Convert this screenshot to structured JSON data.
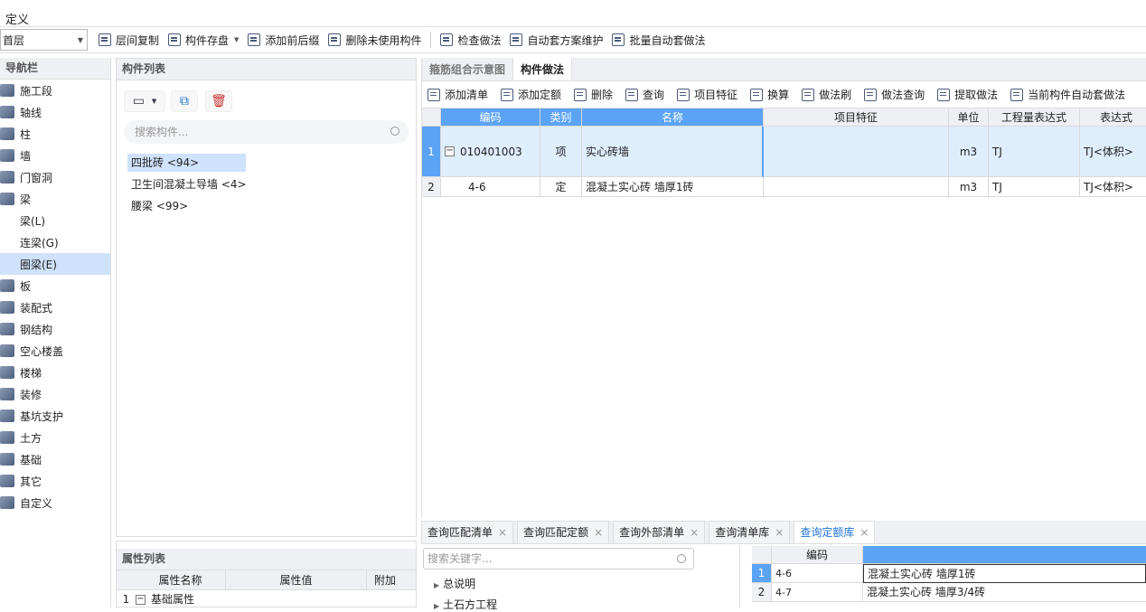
{
  "menu": {
    "title": "定义"
  },
  "toolbar": {
    "floor": "首层",
    "buttons": [
      "层间复制",
      "构件存盘",
      "添加前后缀",
      "删除未使用构件",
      "检查做法",
      "自动套方案维护",
      "批量自动套做法"
    ]
  },
  "nav": {
    "title": "导航栏",
    "items": [
      {
        "label": "施工段",
        "sub": false,
        "sel": false
      },
      {
        "label": "轴线",
        "sub": false,
        "sel": false
      },
      {
        "label": "柱",
        "sub": false,
        "sel": false
      },
      {
        "label": "墙",
        "sub": false,
        "sel": false
      },
      {
        "label": "门窗洞",
        "sub": false,
        "sel": false
      },
      {
        "label": "梁",
        "sub": false,
        "sel": false
      },
      {
        "label": "梁(L)",
        "sub": true,
        "sel": false
      },
      {
        "label": "连梁(G)",
        "sub": true,
        "sel": false
      },
      {
        "label": "圈梁(E)",
        "sub": true,
        "sel": true
      },
      {
        "label": "板",
        "sub": false,
        "sel": false
      },
      {
        "label": "装配式",
        "sub": false,
        "sel": false
      },
      {
        "label": "钢结构",
        "sub": false,
        "sel": false
      },
      {
        "label": "空心楼盖",
        "sub": false,
        "sel": false
      },
      {
        "label": "楼梯",
        "sub": false,
        "sel": false
      },
      {
        "label": "装修",
        "sub": false,
        "sel": false
      },
      {
        "label": "基坑支护",
        "sub": false,
        "sel": false
      },
      {
        "label": "土方",
        "sub": false,
        "sel": false
      },
      {
        "label": "基础",
        "sub": false,
        "sel": false
      },
      {
        "label": "其它",
        "sub": false,
        "sel": false
      },
      {
        "label": "自定义",
        "sub": false,
        "sel": false
      }
    ]
  },
  "complist": {
    "title": "构件列表",
    "search_placeholder": "搜索构件...",
    "items": [
      "四批砖 <94>",
      "卫生间混凝土导墙 <4>",
      "腰梁 <99>"
    ]
  },
  "proplist": {
    "title": "属性列表",
    "cols": [
      "属性名称",
      "属性值",
      "附加"
    ],
    "row_num": "1",
    "row_toggle": "−",
    "row_label": "基础属性"
  },
  "main": {
    "tabs": [
      "箍筋组合示意图",
      "构件做法"
    ],
    "tools": [
      "添加清单",
      "添加定额",
      "删除",
      "查询",
      "项目特征",
      "换算",
      "做法刷",
      "做法查询",
      "提取做法",
      "当前构件自动套做法"
    ],
    "cols": [
      "编码",
      "类别",
      "名称",
      "项目特征",
      "单位",
      "工程量表达式",
      "表达式"
    ],
    "rows": [
      {
        "num": "1",
        "toggle": "−",
        "code": "010401003",
        "type": "项",
        "name": "实心砖墙",
        "feat": "",
        "unit": "m3",
        "expr": "TJ",
        "desc": "TJ<体积>"
      },
      {
        "num": "2",
        "toggle": "",
        "code": "4-6",
        "type": "定",
        "name": "混凝土实心砖 墙厚1砖",
        "feat": "",
        "unit": "m3",
        "expr": "TJ",
        "desc": "TJ<体积>"
      }
    ]
  },
  "bottom": {
    "tabs": [
      "查询匹配清单",
      "查询匹配定额",
      "查询外部清单",
      "查询清单库",
      "查询定额库"
    ],
    "close": "×",
    "search_placeholder": "搜索关键字...",
    "tree": [
      "总说明",
      "土石方工程"
    ],
    "grid_head": "编码",
    "rows": [
      {
        "num": "1",
        "code": "4-6",
        "name": "混凝土实心砖 墙厚1砖"
      },
      {
        "num": "2",
        "code": "4-7",
        "name": "混凝土实心砖 墙厚3/4砖"
      }
    ]
  }
}
